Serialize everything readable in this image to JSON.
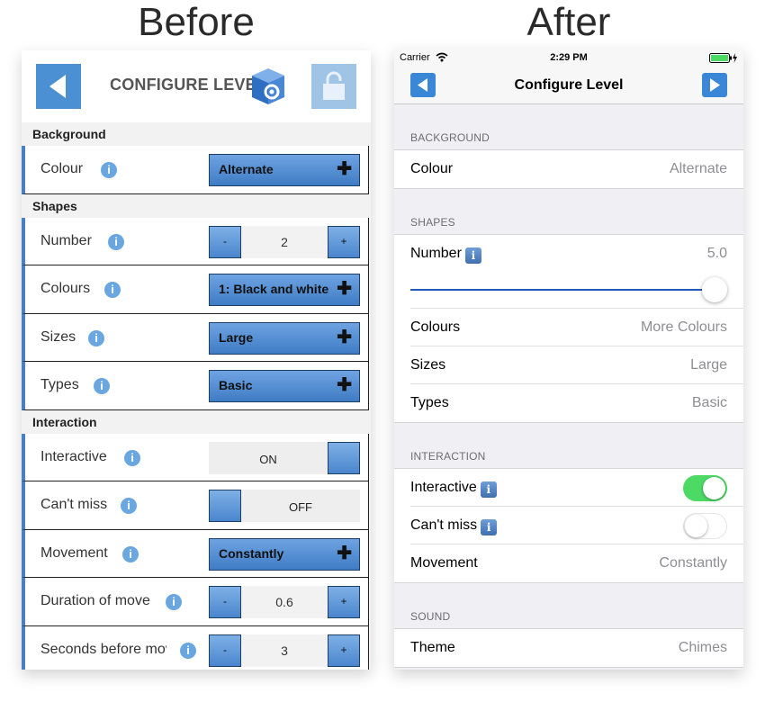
{
  "titles": {
    "before": "Before",
    "after": "After"
  },
  "before": {
    "header_title": "CONFIGURE LEVEL",
    "sections": {
      "background": "Background",
      "shapes": "Shapes",
      "interaction": "Interaction"
    },
    "rows": {
      "colour": {
        "label": "Colour",
        "value": "Alternate"
      },
      "number": {
        "label": "Number",
        "value": "2"
      },
      "colours": {
        "label": "Colours",
        "value": "1: Black and white"
      },
      "sizes": {
        "label": "Sizes",
        "value": "Large"
      },
      "types": {
        "label": "Types",
        "value": "Basic"
      },
      "interactive": {
        "label": "Interactive",
        "value": "ON"
      },
      "cant_miss": {
        "label": "Can't miss",
        "value": "OFF"
      },
      "movement": {
        "label": "Movement",
        "value": "Constantly"
      },
      "duration": {
        "label": "Duration of move",
        "value": "0.6"
      },
      "seconds": {
        "label": "Seconds before mov",
        "value": "3"
      }
    },
    "glyphs": {
      "info": "i",
      "plus": "✚",
      "minus": "-",
      "step_plus": "+"
    },
    "colors": {
      "accent": "#4a90d2",
      "select_top": "#6ea3e1",
      "select_bottom": "#3f7cc5"
    }
  },
  "after": {
    "status": {
      "carrier": "Carrier",
      "time": "2:29 PM"
    },
    "nav_title": "Configure Level",
    "sections": {
      "background": "BACKGROUND",
      "shapes": "SHAPES",
      "interaction": "INTERACTION",
      "sound": "SOUND"
    },
    "rows": {
      "colour": {
        "label": "Colour",
        "value": "Alternate"
      },
      "number": {
        "label": "Number",
        "value": "5.0"
      },
      "colours": {
        "label": "Colours",
        "value": "More Colours"
      },
      "sizes": {
        "label": "Sizes",
        "value": "Large"
      },
      "types": {
        "label": "Types",
        "value": "Basic"
      },
      "interactive": {
        "label": "Interactive",
        "on": true
      },
      "cant_miss": {
        "label": "Can't miss",
        "on": false
      },
      "movement": {
        "label": "Movement",
        "value": "Constantly"
      },
      "theme": {
        "label": "Theme",
        "value": "Chimes"
      }
    },
    "slider_level": 1.0,
    "glyphs": {
      "info": "i"
    },
    "colors": {
      "switch_on": "#4cd964",
      "nav_button": "#3a87d8",
      "slider_track": "#1f5db8"
    }
  }
}
